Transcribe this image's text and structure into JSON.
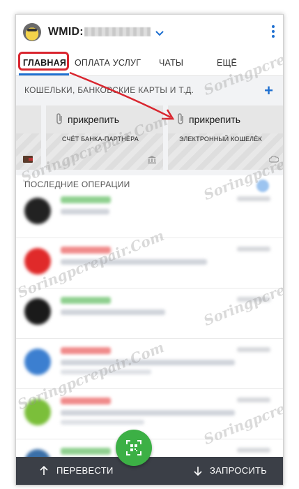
{
  "header": {
    "wmid_label": "WMID:",
    "dropdown_icon": "chevron-down-icon",
    "menu_icon": "kebab-menu-icon"
  },
  "tabs": [
    {
      "label": "ГЛАВНАЯ",
      "active": true
    },
    {
      "label": "ОПЛАТА УСЛУГ",
      "active": false
    },
    {
      "label": "ЧАТЫ",
      "active": false
    },
    {
      "label": "ЕЩЁ",
      "active": false
    }
  ],
  "wallets": {
    "title": "КОШЕЛЬКИ, БАНКОВСКИЕ КАРТЫ И Т.Д.",
    "add_icon": "plus-icon",
    "cards": [
      {
        "attach_label": "прикрепить",
        "subtitle": "СЧЁТ БАНКА-ПАРТНЁРА",
        "icon": "bank-icon"
      },
      {
        "attach_label": "прикрепить",
        "subtitle": "ЭЛЕКТРОННЫЙ КОШЕЛЁК",
        "icon": "cloud-icon"
      }
    ]
  },
  "operations": {
    "title": "ПОСЛЕДНИЕ ОПЕРАЦИИ"
  },
  "bottom_bar": {
    "send_label": "ПЕРЕВЕСТИ",
    "request_label": "ЗАПРОСИТЬ",
    "qr_icon": "qr-code-icon"
  },
  "watermark": "Soringpcrepair.Com",
  "colors": {
    "accent": "#1e6fd0",
    "highlight": "#d9262f",
    "fab": "#3cb045",
    "bottom_bar": "#3b3f47"
  }
}
